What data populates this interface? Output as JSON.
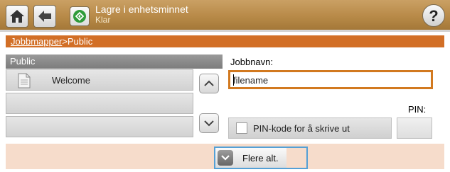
{
  "header": {
    "title": "Lagre i enhetsminnet",
    "status": "Klar",
    "help_symbol": "?"
  },
  "breadcrumb": {
    "link": "Jobbmapper",
    "separator": ">",
    "current": "Public"
  },
  "folder_list": {
    "header": "Public",
    "items": [
      {
        "label": "Welcome",
        "icon": "document-icon"
      },
      {
        "label": ""
      },
      {
        "label": ""
      }
    ]
  },
  "job_name": {
    "label": "Jobbnavn:",
    "value": "filename"
  },
  "pin": {
    "label": "PIN:",
    "checkbox_label": "PIN-kode for å skrive ut",
    "checked": false,
    "value": ""
  },
  "footer": {
    "more_options_label": "Flere alt."
  },
  "colors": {
    "header_bar": "#b88a48",
    "breadcrumb_bar": "#d26f26",
    "field_border": "#d2791f",
    "footer_bg": "#f6dccb",
    "focus_outline": "#54a0d6"
  }
}
